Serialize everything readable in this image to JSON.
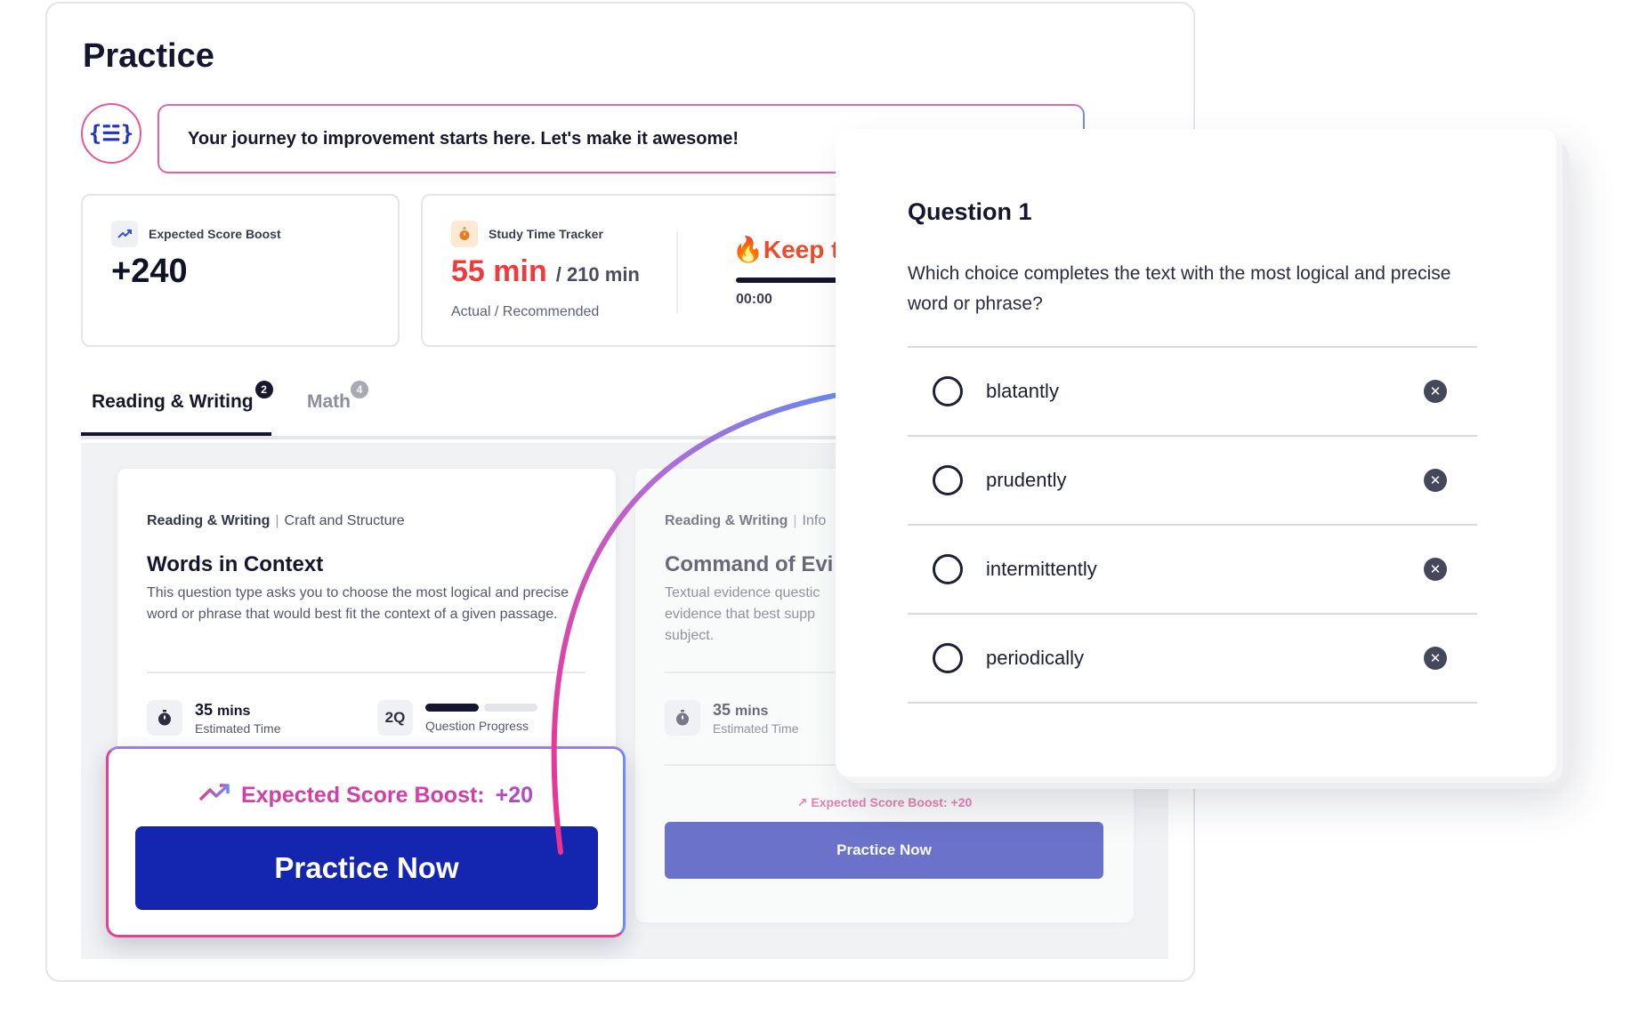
{
  "page": {
    "title": "Practice"
  },
  "mascot": {
    "glyph": "{☱}"
  },
  "banner": {
    "message": "Your journey to improvement starts here. Let's make it awesome!"
  },
  "stats": {
    "boost": {
      "icon": "trend-up-icon",
      "label": "Expected Score Boost",
      "value": "+240"
    },
    "timer": {
      "icon": "stopwatch-icon",
      "label": "Study Time Tracker",
      "actual": "55 min",
      "recommended": "/ 210 min",
      "caption": "Actual / Recommended",
      "streak": "🔥Keep t",
      "elapsed": "00:00"
    }
  },
  "tabs": [
    {
      "label": "Reading & Writing",
      "count": "2",
      "active": true
    },
    {
      "label": "Math",
      "count": "4",
      "active": false
    }
  ],
  "cards": [
    {
      "category": "Reading & Writing",
      "subcategory": "Craft and Structure",
      "title": "Words in Context",
      "description": "This question type asks you to choose the most logical and precise word or phrase that would best fit the context of a given passage.",
      "time_value": "35",
      "time_unit": "mins",
      "time_label": "Estimated Time",
      "question_count": "2Q",
      "progress_label": "Question Progress",
      "progress_done": 1,
      "progress_total": 2,
      "boost_label": "Expected Score Boost:",
      "boost_value": "+20",
      "button": "Practice Now"
    },
    {
      "category": "Reading & Writing",
      "subcategory": "Info",
      "title": "Command of Evi",
      "description": "Textual evidence questic evidence that best supp subject.",
      "time_value": "35",
      "time_unit": "mins",
      "time_label": "Estimated Time",
      "boost_label": "Expected Score Boost:",
      "boost_value": "+20",
      "button": "Practice Now"
    }
  ],
  "question": {
    "title": "Question 1",
    "prompt": "Which choice completes the text with the most logical and precise word or phrase?",
    "options": [
      {
        "text": "blatantly"
      },
      {
        "text": "prudently"
      },
      {
        "text": "intermittently"
      },
      {
        "text": "periodically"
      }
    ]
  },
  "colors": {
    "primary_button": "#1426b0",
    "boost_pink": "#e23c90",
    "accent_blue": "#6f8cf3",
    "timer_red": "#ef3b3b"
  }
}
